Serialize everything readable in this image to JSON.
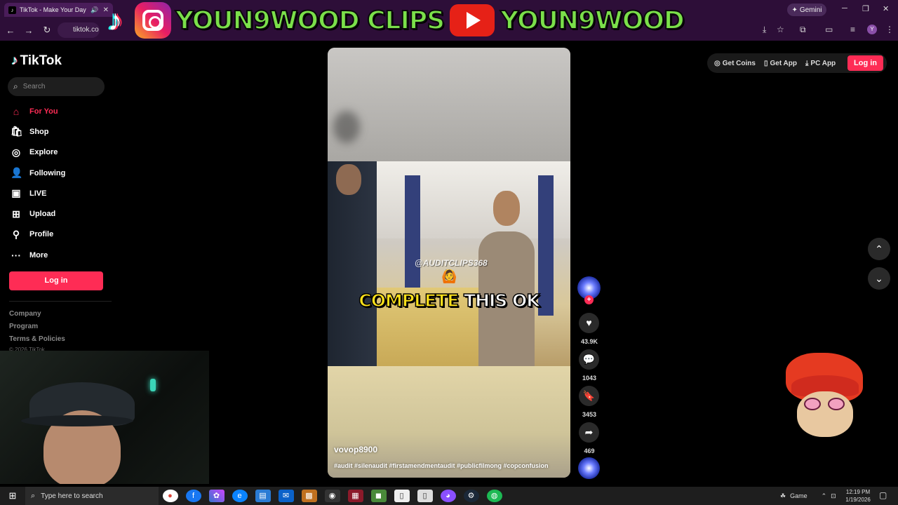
{
  "browser": {
    "tab_title": "TikTok - Make Your Day",
    "url": "tiktok.co",
    "gemini_label": "Gemini",
    "profile_initial": "Y"
  },
  "banner": {
    "text_left": "YOUN9WOOD CLIPS",
    "text_right": "YOUN9WOOD"
  },
  "tiktok": {
    "logo_text": "TikTok",
    "search_placeholder": "Search",
    "nav": [
      {
        "label": "For You",
        "icon": "home-icon",
        "active": true
      },
      {
        "label": "Shop",
        "icon": "shop-bag-icon"
      },
      {
        "label": "Explore",
        "icon": "compass-icon"
      },
      {
        "label": "Following",
        "icon": "following-icon"
      },
      {
        "label": "LIVE",
        "icon": "live-icon"
      },
      {
        "label": "Upload",
        "icon": "upload-icon"
      },
      {
        "label": "Profile",
        "icon": "profile-icon"
      },
      {
        "label": "More",
        "icon": "more-icon"
      }
    ],
    "login_label": "Log in",
    "footer": {
      "company": "Company",
      "program": "Program",
      "terms": "Terms & Policies",
      "copyright": "© 2026 TikTok"
    },
    "top_actions": {
      "get_coins": "Get Coins",
      "get_app": "Get App",
      "pc_app": "PC App",
      "login": "Log in"
    }
  },
  "video": {
    "watermark": "@AUDITCLIPS368",
    "caption_highlight": "COMPLETE",
    "caption_rest": "THIS OK",
    "username": "vovop8900",
    "hashtags": "#audit #silenaudit #firstamendmentaudit #publicfilmong #copconfusion",
    "likes": "43.9K",
    "comments": "1043",
    "saves": "3453",
    "shares": "469"
  },
  "taskbar": {
    "search_placeholder": "Type here to search",
    "game_label": "Game",
    "time": "12:19 PM",
    "date": "1/19/2026"
  },
  "colors": {
    "brand_pink": "#fe2c55",
    "chrome_bg": "#2d0e38",
    "banner_green": "#7be04a"
  }
}
